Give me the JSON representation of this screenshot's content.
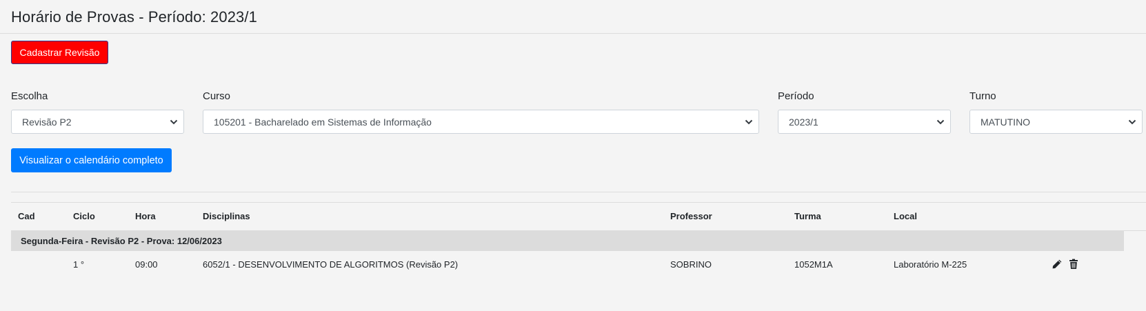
{
  "page": {
    "title": "Horário de Provas - Período: 2023/1",
    "register_button": "Cadastrar Revisão",
    "calendar_button": "Visualizar o calendário completo"
  },
  "colors": {
    "register_button_bg": "#ff0000",
    "calendar_button_bg": "#007bff",
    "group_row_bg": "#dcdcdc"
  },
  "filters": {
    "escolha": {
      "label": "Escolha",
      "value": "Revisão P2"
    },
    "curso": {
      "label": "Curso",
      "value": "105201 - Bacharelado em Sistemas de Informação"
    },
    "periodo": {
      "label": "Período",
      "value": "2023/1"
    },
    "turno": {
      "label": "Turno",
      "value": "MATUTINO"
    }
  },
  "table": {
    "headers": {
      "cad": "Cad",
      "ciclo": "Ciclo",
      "hora": "Hora",
      "disciplinas": "Disciplinas",
      "professor": "Professor",
      "turma": "Turma",
      "local": "Local"
    },
    "group": {
      "label": "Segunda-Feira - Revisão P2 - Prova: 12/06/2023"
    },
    "rows": [
      {
        "cad": "",
        "ciclo": "1 °",
        "hora": "09:00",
        "disciplina": "6052/1 - DESENVOLVIMENTO DE ALGORITMOS (Revisão P2)",
        "professor": "SOBRINO",
        "turma": "1052M1A",
        "local": "Laboratório M-225",
        "actions": [
          "pencil-icon",
          "trash-icon"
        ]
      }
    ]
  }
}
